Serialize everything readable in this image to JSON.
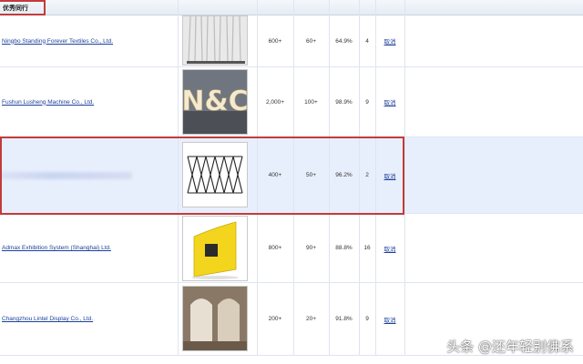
{
  "header": {
    "title": "优秀同行"
  },
  "rows": [
    {
      "company": "Ningbo Standing Forever Textiles Co., Ltd.",
      "image": "curtain-display-photo",
      "col1": "600+",
      "col2": "60+",
      "rate": "64.9%",
      "count": "4",
      "action": "取消"
    },
    {
      "company": "Fushun Lusheng Machine Co., Ltd.",
      "image": "marquee-letters-photo",
      "image_text": "N&C",
      "col1": "2,000+",
      "col2": "100+",
      "rate": "98.9%",
      "count": "9",
      "action": "取消"
    },
    {
      "company": "",
      "image": "scissor-frame-photo",
      "col1": "400+",
      "col2": "50+",
      "rate": "96.2%",
      "count": "2",
      "action": "取消",
      "highlighted": true,
      "company_blurred": true
    },
    {
      "company": "Admax Exhibition System (Shanghai) Ltd.",
      "image": "yellow-backdrop-photo",
      "col1": "800+",
      "col2": "90+",
      "rate": "88.8%",
      "count": "16",
      "action": "取消"
    },
    {
      "company": "Changzhou Lintel Display Co., Ltd.",
      "image": "corridor-arch-photo",
      "col1": "200+",
      "col2": "20+",
      "rate": "91.8%",
      "count": "9",
      "action": "取消"
    }
  ],
  "watermark": "头条 @还年轻别佛系",
  "colors": {
    "link": "#1c3f9a",
    "highlight_border": "#c23b3b",
    "highlight_row": "#e8effc"
  }
}
